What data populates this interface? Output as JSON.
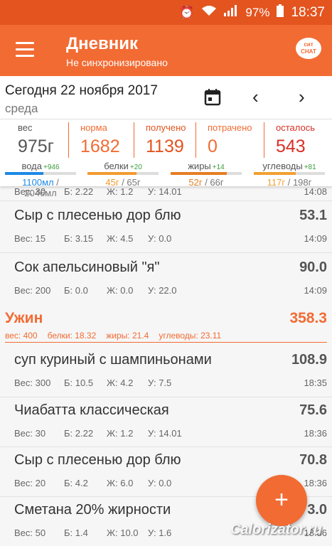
{
  "status_bar": {
    "battery": "97%",
    "time": "18:37"
  },
  "header": {
    "title": "Дневник",
    "subtitle": "Не синхронизировано",
    "chat_badge": "сит\nСНАТ"
  },
  "date_bar": {
    "date": "Сегодня 22 ноября 2017",
    "weekday": "среда"
  },
  "summary": {
    "stats": [
      {
        "label": "вес",
        "value": "975г"
      },
      {
        "label": "норма",
        "value": "1682"
      },
      {
        "label": "получено",
        "value": "1139"
      },
      {
        "label": "потрачено",
        "value": "0"
      },
      {
        "label": "осталось",
        "value": "543"
      }
    ],
    "macros": [
      {
        "label": "вода",
        "delta": "+946",
        "value": "1100мл",
        "total": "2046мл",
        "fill": 0.54
      },
      {
        "label": "белки",
        "delta": "+20",
        "value": "45г",
        "total": "65г",
        "fill": 0.69
      },
      {
        "label": "жиры",
        "delta": "+14",
        "value": "52г",
        "total": "66г",
        "fill": 0.79
      },
      {
        "label": "углеводы",
        "delta": "+81",
        "value": "117г",
        "total": "198г",
        "fill": 0.59
      }
    ],
    "colors": {
      "ves": "#555555",
      "norma": "#f26b33",
      "poluch": "#e3541f",
      "potr": "#f26b33",
      "ostal": "#d93025",
      "voda": "#1e88e5",
      "belki": "#f29b2f",
      "zhiry": "#e67e22",
      "uglevody": "#f0a030"
    }
  },
  "partial_row": {
    "weight": "Вес: 30",
    "b": "Б: 2.22",
    "zh": "Ж: 1.2",
    "u": "У: 14.01",
    "time": "14:08"
  },
  "items_before": [
    {
      "name": "Сыр с плесенью дор блю",
      "kcal": "53.1",
      "weight": "Вес: 15",
      "b": "Б: 3.15",
      "zh": "Ж: 4.5",
      "u": "У: 0.0",
      "time": "14:09"
    },
    {
      "name": "Сок апельсиновый \"я\"",
      "kcal": "90.0",
      "weight": "Вес: 200",
      "b": "Б: 0.0",
      "zh": "Ж: 0.0",
      "u": "У: 22.0",
      "time": "14:09"
    }
  ],
  "dinner": {
    "name": "Ужин",
    "kcal": "358.3",
    "weight": "вес: 400",
    "belki": "белки: 18.32",
    "zhiry": "жиры: 21.4",
    "uglevody": "углеводы: 23.11"
  },
  "items_dinner": [
    {
      "name": "суп куриный с шампиньонами",
      "kcal": "108.9",
      "weight": "Вес: 300",
      "b": "Б: 10.5",
      "zh": "Ж: 4.2",
      "u": "У: 7.5",
      "time": "18:35"
    },
    {
      "name": "Чиабатта классическая",
      "kcal": "75.6",
      "weight": "Вес: 30",
      "b": "Б: 2.22",
      "zh": "Ж: 1.2",
      "u": "У: 14.01",
      "time": "18:36"
    },
    {
      "name": "Сыр с плесенью дор блю",
      "kcal": "70.8",
      "weight": "Вес: 20",
      "b": "Б: 4.2",
      "zh": "Ж: 6.0",
      "u": "У: 0.0",
      "time": "18:36"
    },
    {
      "name": "Сметана 20% жирности",
      "kcal": "3.0",
      "weight": "Вес: 50",
      "b": "Б: 1.4",
      "zh": "Ж: 10.0",
      "u": "У: 1.6",
      "time": "18:36"
    }
  ],
  "fab": {
    "label": "+"
  },
  "watermark": "Calorizator.ru"
}
